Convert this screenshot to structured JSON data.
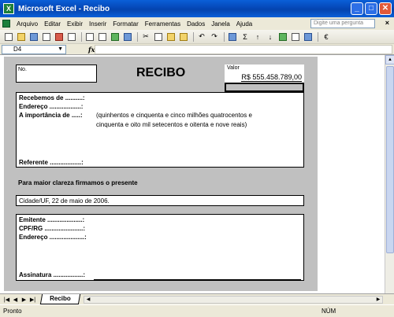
{
  "window": {
    "title": "Microsoft Excel - Recibo"
  },
  "menu": {
    "items": [
      "Arquivo",
      "Editar",
      "Exibir",
      "Inserir",
      "Formatar",
      "Ferramentas",
      "Dados",
      "Janela",
      "Ajuda"
    ],
    "ask_placeholder": "Digite uma pergunta"
  },
  "formula_bar": {
    "cell_ref": "D4",
    "fx": "fx"
  },
  "receipt": {
    "no_label": "No.",
    "title": "RECIBO",
    "valor_label": "Valor",
    "valor": "R$ 555.458.789,00",
    "recebemos": "Recebemos de ..........:",
    "endereco": "Endereço ..................:",
    "importancia": "A importância de .....:",
    "amount_words_line1": "(quinhentos e cinquenta e cinco milhões quatrocentos e",
    "amount_words_line2": "cinquenta e oito mil setecentos e oitenta e nove reais)",
    "referente": "Referente ..................:",
    "clareza": "Para maior clareza firmamos o presente",
    "cidade_data": "Cidade/UF, 22 de maio de 2006.",
    "emitente": "Emitente ....................:",
    "cpf_rg": "CPF/RG ......................:",
    "endereco2": "Endereço ....................:",
    "assinatura": "Assinatura .................:"
  },
  "sheet_tabs": {
    "active": "Recibo"
  },
  "status": {
    "left": "Pronto",
    "num": "NÚM"
  }
}
